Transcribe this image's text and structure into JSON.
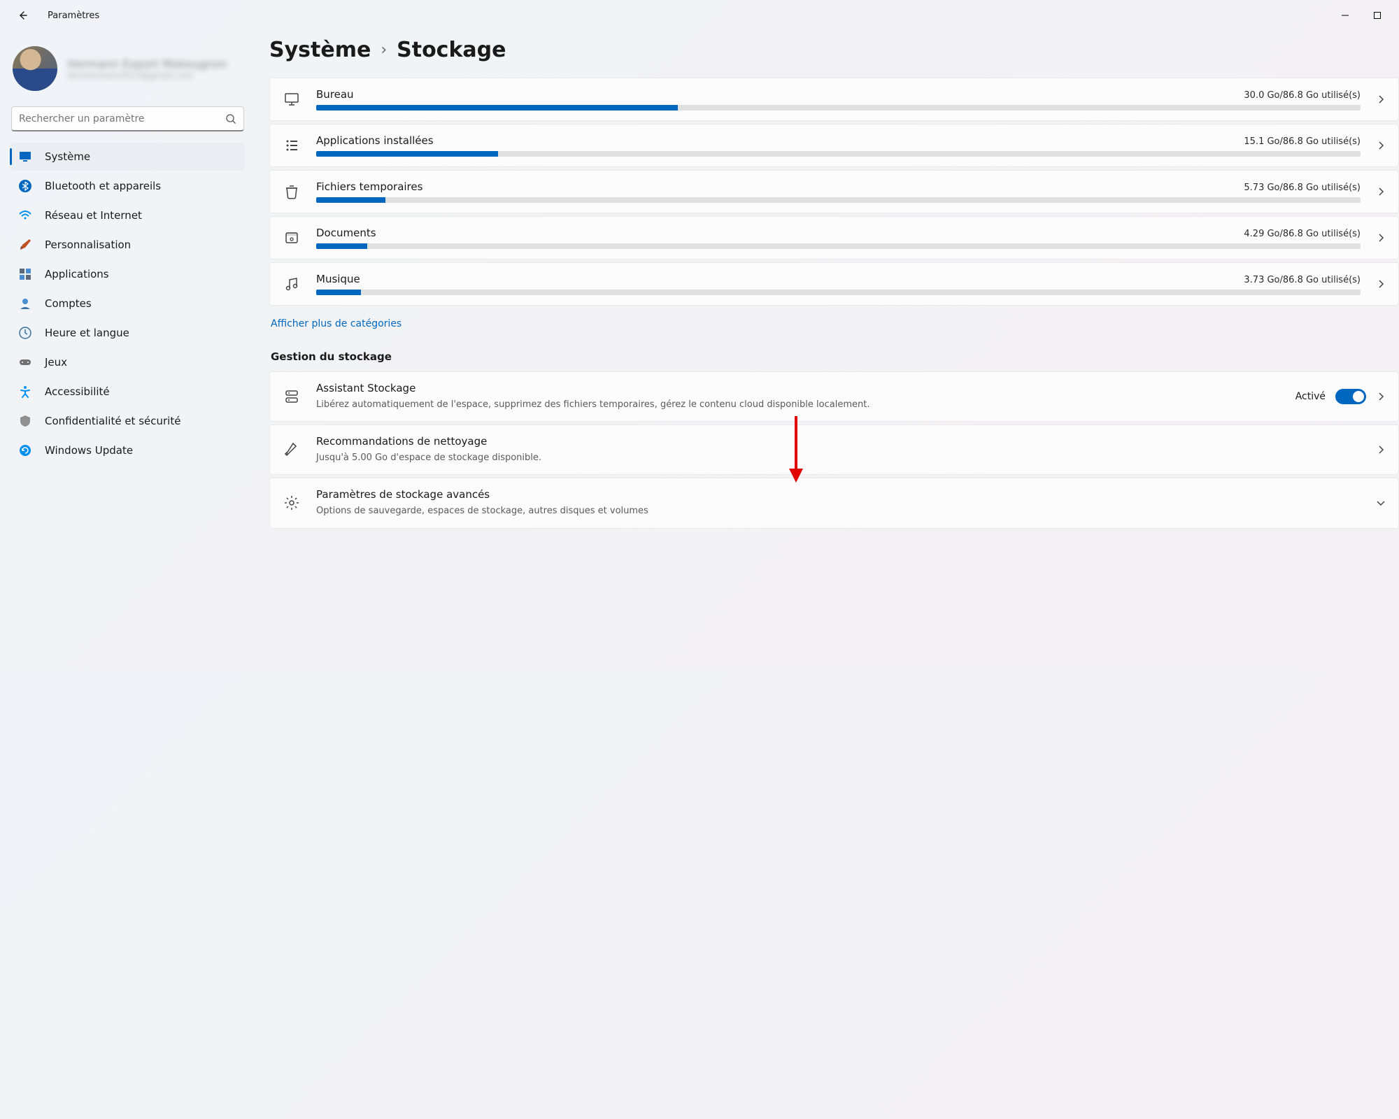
{
  "app_title": "Paramètres",
  "profile": {
    "name": "Hermann Export Mokougnon",
    "email": "dochermann2013@gmail.com"
  },
  "search": {
    "placeholder": "Rechercher un paramètre"
  },
  "nav": [
    {
      "id": "system",
      "label": "Système",
      "active": true
    },
    {
      "id": "bluetooth",
      "label": "Bluetooth et appareils"
    },
    {
      "id": "network",
      "label": "Réseau et Internet"
    },
    {
      "id": "personalization",
      "label": "Personnalisation"
    },
    {
      "id": "apps",
      "label": "Applications"
    },
    {
      "id": "accounts",
      "label": "Comptes"
    },
    {
      "id": "time",
      "label": "Heure et langue"
    },
    {
      "id": "gaming",
      "label": "Jeux"
    },
    {
      "id": "accessibility",
      "label": "Accessibilité"
    },
    {
      "id": "privacy",
      "label": "Confidentialité et sécurité"
    },
    {
      "id": "update",
      "label": "Windows Update"
    }
  ],
  "breadcrumb": {
    "parent": "Système",
    "current": "Stockage"
  },
  "storage": {
    "total": "86.8 Go",
    "items": [
      {
        "id": "desktop",
        "label": "Bureau",
        "usage": "30.0 Go/86.8 Go utilisé(s)",
        "pct": 34.6
      },
      {
        "id": "apps",
        "label": "Applications installées",
        "usage": "15.1 Go/86.8 Go utilisé(s)",
        "pct": 17.4
      },
      {
        "id": "temp",
        "label": "Fichiers temporaires",
        "usage": "5.73 Go/86.8 Go utilisé(s)",
        "pct": 6.6
      },
      {
        "id": "docs",
        "label": "Documents",
        "usage": "4.29 Go/86.8 Go utilisé(s)",
        "pct": 4.9
      },
      {
        "id": "music",
        "label": "Musique",
        "usage": "3.73 Go/86.8 Go utilisé(s)",
        "pct": 4.3
      }
    ],
    "more_link": "Afficher plus de catégories"
  },
  "management": {
    "title": "Gestion du stockage",
    "storage_sense": {
      "title": "Assistant Stockage",
      "desc": "Libérez automatiquement de l'espace, supprimez des fichiers temporaires, gérez le contenu cloud disponible localement.",
      "state_label": "Activé",
      "enabled": true
    },
    "cleanup": {
      "title": "Recommandations de nettoyage",
      "desc": "Jusqu'à 5.00 Go d'espace de stockage disponible."
    },
    "advanced": {
      "title": "Paramètres de stockage avancés",
      "desc": "Options de sauvegarde, espaces de stockage, autres disques et volumes"
    }
  },
  "colors": {
    "accent": "#0067c0"
  }
}
